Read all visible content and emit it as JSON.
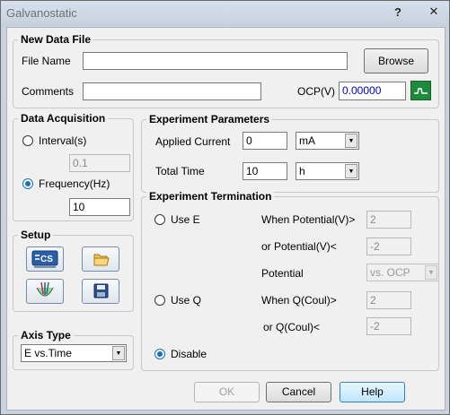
{
  "window": {
    "title": "Galvanostatic",
    "help_glyph": "?",
    "close_glyph": "✕"
  },
  "new_data_file": {
    "legend": "New Data File",
    "file_name_label": "File Name",
    "file_name_value": "",
    "browse_label": "Browse",
    "comments_label": "Comments",
    "comments_value": "",
    "ocp_label": "OCP(V)",
    "ocp_value": "0.00000",
    "ocp_icon": "waveform-icon"
  },
  "data_acquisition": {
    "legend": "Data Acquisition",
    "interval_label": "Interval(s)",
    "interval_value": "0.1",
    "frequency_label": "Frequency(Hz)",
    "frequency_value": "10",
    "selected": "frequency"
  },
  "setup": {
    "legend": "Setup",
    "icons": [
      "cs-instrument-icon",
      "open-folder-icon",
      "electrode-cell-icon",
      "save-disk-icon"
    ]
  },
  "axis_type": {
    "legend": "Axis Type",
    "value": "E vs.Time"
  },
  "experiment_parameters": {
    "legend": "Experiment Parameters",
    "applied_current_label": "Applied Current",
    "applied_current_value": "0",
    "applied_current_unit": "mA",
    "total_time_label": "Total Time",
    "total_time_value": "10",
    "total_time_unit": "h"
  },
  "experiment_termination": {
    "legend": "Experiment Termination",
    "use_e_label": "Use E",
    "when_potential_label": "When Potential(V)>",
    "when_potential_value": "2",
    "or_potential_label": "or Potential(V)<",
    "or_potential_value": "-2",
    "potential_label": "Potential",
    "potential_ref": "vs. OCP",
    "use_q_label": "Use Q",
    "when_q_label": "When Q(Coul)>",
    "when_q_value": "2",
    "or_q_label": "or Q(Coul)<",
    "or_q_value": "-2",
    "disable_label": "Disable",
    "selected": "disable"
  },
  "buttons": {
    "ok": "OK",
    "cancel": "Cancel",
    "help": "Help"
  },
  "colors": {
    "accent": "#1a6ec0",
    "ocp_text": "#0000c8",
    "ocp_button": "#1e8a3c"
  }
}
